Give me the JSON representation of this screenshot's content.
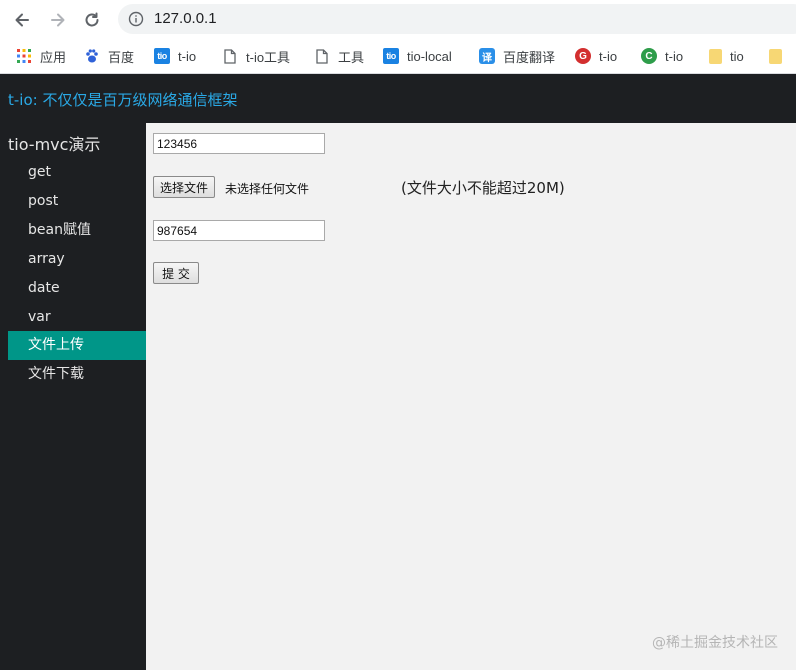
{
  "browser": {
    "url": "127.0.0.1",
    "bookmarks": [
      {
        "label": "应用",
        "icon": "apps-grid-icon"
      },
      {
        "label": "百度",
        "icon": "baidu-paw-icon"
      },
      {
        "label": "t-io",
        "icon": "tio-icon",
        "icon_text": "tio"
      },
      {
        "label": "t-io工具",
        "icon": "page-icon"
      },
      {
        "label": "工具",
        "icon": "page-icon"
      },
      {
        "label": "tio-local",
        "icon": "tio-icon",
        "icon_text": "tio"
      },
      {
        "label": "百度翻译",
        "icon": "translate-icon",
        "icon_text": "译"
      },
      {
        "label": "t-io",
        "icon": "g-circle-icon",
        "icon_text": "G"
      },
      {
        "label": "t-io",
        "icon": "c-circle-icon",
        "icon_text": "C"
      },
      {
        "label": "tio",
        "icon": "folder-icon"
      }
    ]
  },
  "header": {
    "title": "t-io: 不仅仅是百万级网络通信框架"
  },
  "sidebar": {
    "title": "tio-mvc演示",
    "items": [
      {
        "label": "get",
        "active": false
      },
      {
        "label": "post",
        "active": false
      },
      {
        "label": "bean赋值",
        "active": false
      },
      {
        "label": "array",
        "active": false
      },
      {
        "label": "date",
        "active": false
      },
      {
        "label": "var",
        "active": false
      },
      {
        "label": "文件上传",
        "active": true
      },
      {
        "label": "文件下载",
        "active": false
      }
    ]
  },
  "form": {
    "field1_value": "123456",
    "choose_file_label": "选择文件",
    "no_file_text": "未选择任何文件",
    "size_note": "(文件大小不能超过20M)",
    "field2_value": "987654",
    "submit_label": "提 交"
  },
  "watermark": "@稀土掘金技术社区",
  "colors": {
    "header_bg": "#1d1f22",
    "header_title": "#2aa9e6",
    "active_item": "#009688",
    "main_bg": "#f2f2f2"
  }
}
